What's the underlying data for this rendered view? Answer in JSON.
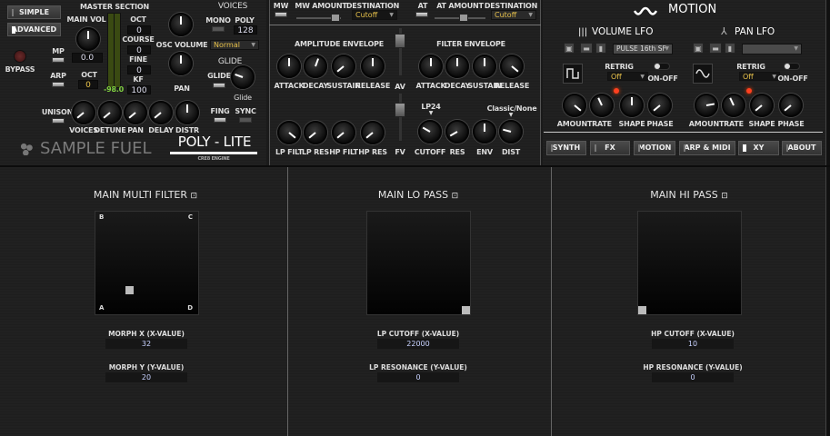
{
  "left": {
    "simple": "SIMPLE",
    "advanced": "ADVANCED",
    "bypass": "BYPASS",
    "master_section": "MASTER SECTION",
    "main_vol": "MAIN VOL",
    "main_vol_value": "0.0",
    "mp": "MP",
    "arp": "ARP",
    "oct": "OCT",
    "oct_value": "0",
    "meter_value": "-98.0",
    "oct2": "OCT",
    "oct2_value": "0",
    "course": "COURSE",
    "course_value": "0",
    "fine": "FINE",
    "fine_value": "0",
    "kf": "KF",
    "kf_value": "100",
    "osc_volume": "OSC VOLUME",
    "pan": "PAN",
    "voices": "VOICES",
    "mono": "MONO",
    "poly": "POLY",
    "poly_value": "128",
    "mode": "Normal",
    "glide_header": "GLIDE",
    "glide": "GLIDE",
    "glide_knob": "Glide",
    "unison": "UNISON",
    "knobs": [
      "VOICES",
      "DETUNE",
      "PAN",
      "DELAY",
      "DISTR"
    ],
    "fing": "FING",
    "sync": "SYNC",
    "brand": "SAMPLE FUEL",
    "product": "POLY - LITE",
    "engine": "CRE8 ENGINE"
  },
  "mid": {
    "mw": "MW",
    "mw_amount": "MW AMOUNT",
    "destination": "DESTINATION",
    "mw_dest": "Cutoff",
    "at": "AT",
    "at_amount": "AT AMOUNT",
    "at_dest": "Cutoff",
    "amp_env": "AMPLITUDE ENVELOPE",
    "filter_env": "FILTER ENVELOPE",
    "amp_knobs": [
      "ATTACK",
      "DECAY",
      "SUSTAIN",
      "RELEASE"
    ],
    "filt_knobs": [
      "ATTACK",
      "DECAY",
      "SUSTAIN",
      "RELEASE"
    ],
    "av": "AV",
    "fv": "FV",
    "filter_knobs": [
      "LP FILT",
      "LP RES",
      "HP FILT",
      "HP RES"
    ],
    "filter_type": "LP24",
    "dist_type": "Classic/None",
    "cut_knobs": [
      "CUTOFF",
      "RES",
      "ENV",
      "DIST"
    ]
  },
  "motion": {
    "title": "MOTION",
    "vol_lfo": "VOLUME LFO",
    "pan_lfo": "PAN LFO",
    "vol_preset": "PULSE 16th SF",
    "pan_preset": "",
    "retrig": "RETRIG",
    "vol_retrig": "Off",
    "pan_retrig": "Off",
    "on_off": "ON-OFF",
    "knobs": [
      "AMOUNT",
      "RATE",
      "SHAPE",
      "PHASE"
    ]
  },
  "tabs": [
    "SYNTH",
    "FX",
    "MOTION",
    "ARP & MIDI",
    "XY",
    "ABOUT"
  ],
  "xy": [
    {
      "title": "MAIN MULTI FILTER",
      "corners": [
        "B",
        "C",
        "A",
        "D"
      ],
      "x_label": "MORPH X (X-VALUE)",
      "x_value": "32",
      "y_label": "MORPH Y (Y-VALUE)",
      "y_value": "20"
    },
    {
      "title": "MAIN LO PASS",
      "x_label": "LP CUTOFF (X-VALUE)",
      "x_value": "22000",
      "y_label": "LP RESONANCE (Y-VALUE)",
      "y_value": "0"
    },
    {
      "title": "MAIN HI PASS",
      "x_label": "HP CUTOFF (X-VALUE)",
      "x_value": "10",
      "y_label": "HP RESONANCE (Y-VALUE)",
      "y_value": "0"
    }
  ]
}
